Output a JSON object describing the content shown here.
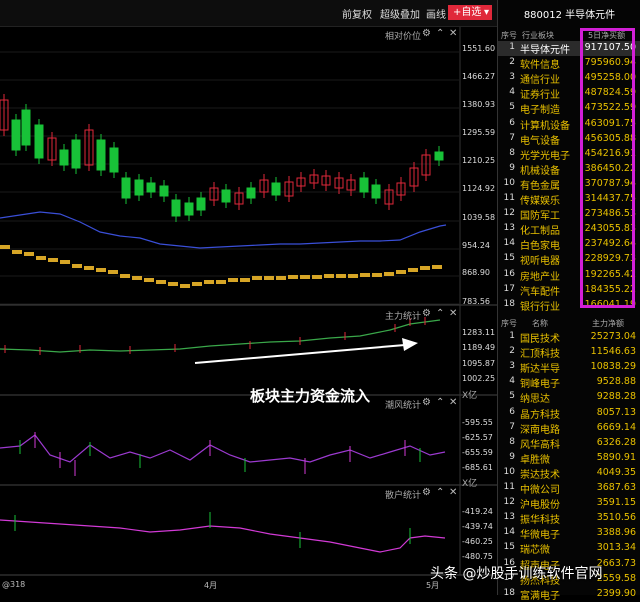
{
  "toolbar": {
    "prev_adjust": "前复权",
    "overlay": "超级叠加",
    "line": "画线",
    "self_select": "+自选"
  },
  "stock": {
    "code_name": "880012 半导体元件"
  },
  "panels": {
    "main_label": "相对价位",
    "capital_label": "主力统计",
    "chaofeng_label": "潮风统计",
    "retail_label": "散户统计",
    "annotation": "板块主力资金流入",
    "x_unit": "X亿"
  },
  "main_y_ticks": [
    "1551.60",
    "1466.27",
    "1380.93",
    "1295.59",
    "1210.25",
    "1124.92",
    "1039.58",
    "954.24",
    "868.90",
    "783.56"
  ],
  "capital_y_ticks": [
    "1283.11",
    "1189.49",
    "1095.87",
    "1002.25"
  ],
  "chaofeng_y_ticks": [
    "-595.55",
    "-625.57",
    "-655.59",
    "-685.61"
  ],
  "retail_y_ticks": [
    "-419.24",
    "-439.74",
    "-460.25",
    "-480.75"
  ],
  "x_labels": [
    "4月",
    "5月"
  ],
  "x_label_left": "@318",
  "industry_table": {
    "headers": {
      "no": "序号",
      "name": "行业板块",
      "value": "5日净买额"
    },
    "rows": [
      {
        "no": "1",
        "name": "半导体元件",
        "value": "917107.50"
      },
      {
        "no": "2",
        "name": "软件信息",
        "value": "795960.94"
      },
      {
        "no": "3",
        "name": "通信行业",
        "value": "495258.00"
      },
      {
        "no": "4",
        "name": "证券行业",
        "value": "487824.59"
      },
      {
        "no": "5",
        "name": "电子制造",
        "value": "473522.59"
      },
      {
        "no": "6",
        "name": "计算机设备",
        "value": "463091.75"
      },
      {
        "no": "7",
        "name": "电气设备",
        "value": "456305.88"
      },
      {
        "no": "8",
        "name": "光学光电子",
        "value": "454216.91"
      },
      {
        "no": "9",
        "name": "机械设备",
        "value": "386450.22"
      },
      {
        "no": "10",
        "name": "有色金属",
        "value": "370787.94"
      },
      {
        "no": "11",
        "name": "传媒娱乐",
        "value": "314437.75"
      },
      {
        "no": "12",
        "name": "国防军工",
        "value": "273486.53"
      },
      {
        "no": "13",
        "name": "化工制品",
        "value": "243055.83"
      },
      {
        "no": "14",
        "name": "白色家电",
        "value": "237492.64"
      },
      {
        "no": "15",
        "name": "视听电器",
        "value": "228929.73"
      },
      {
        "no": "16",
        "name": "房地产业",
        "value": "192265.42"
      },
      {
        "no": "17",
        "name": "汽车配件",
        "value": "184355.22"
      },
      {
        "no": "18",
        "name": "银行行业",
        "value": "166041.19"
      }
    ]
  },
  "stock_table": {
    "headers": {
      "no": "序号",
      "name": "名称",
      "value": "主力净额"
    },
    "rows": [
      {
        "no": "1",
        "name": "国民技术",
        "value": "25273.04"
      },
      {
        "no": "2",
        "name": "汇顶科技",
        "value": "11546.63"
      },
      {
        "no": "3",
        "name": "斯达半导",
        "value": "10838.29"
      },
      {
        "no": "4",
        "name": "铜峰电子",
        "value": "9528.88"
      },
      {
        "no": "5",
        "name": "纳思达",
        "value": "9288.28"
      },
      {
        "no": "6",
        "name": "晶方科技",
        "value": "8057.13"
      },
      {
        "no": "7",
        "name": "深南电路",
        "value": "6669.14"
      },
      {
        "no": "8",
        "name": "风华高科",
        "value": "6326.28"
      },
      {
        "no": "9",
        "name": "卓胜微",
        "value": "5890.91"
      },
      {
        "no": "10",
        "name": "崇达技术",
        "value": "4049.35"
      },
      {
        "no": "11",
        "name": "中微公司",
        "value": "3687.63"
      },
      {
        "no": "12",
        "name": "沪电股份",
        "value": "3591.15"
      },
      {
        "no": "13",
        "name": "振华科技",
        "value": "3510.56"
      },
      {
        "no": "14",
        "name": "华微电子",
        "value": "3388.96"
      },
      {
        "no": "15",
        "name": "瑞芯微",
        "value": "3013.34"
      },
      {
        "no": "16",
        "name": "超声电子",
        "value": "2663.73"
      },
      {
        "no": "17",
        "name": "扬杰科技",
        "value": "2559.58"
      },
      {
        "no": "18",
        "name": "富满电子",
        "value": "2399.90"
      }
    ]
  },
  "watermark": "头条 @炒股手训练软件官网",
  "colors": {
    "up": "#e0283a",
    "down": "#18c238",
    "ma1": "#3a4fd8",
    "ma2": "#d6a526",
    "highlight": "#d21fd6",
    "accent_text": "#e8c000"
  }
}
